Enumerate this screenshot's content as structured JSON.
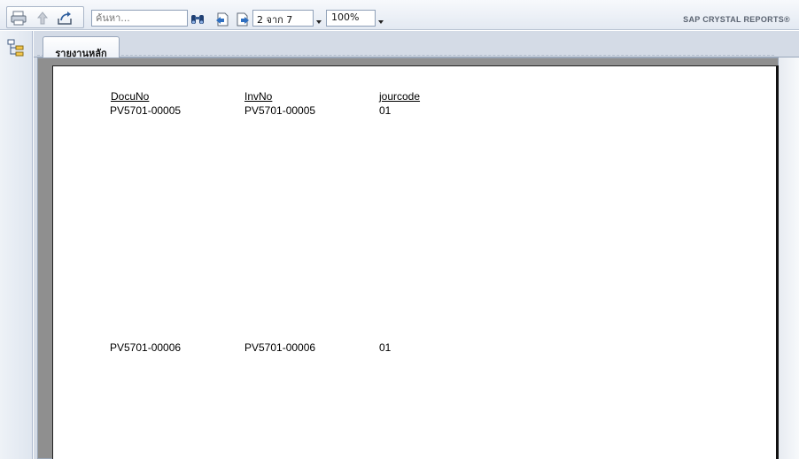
{
  "toolbar": {
    "search": {
      "placeholder": "ค้นหา..."
    },
    "page_indicator": "2 จาก 7",
    "zoom": "100%",
    "brand": "SAP CRYSTAL REPORTS®"
  },
  "tabs": [
    {
      "label": "รายงานหลัก"
    }
  ],
  "report": {
    "headers": {
      "docuno": "DocuNo",
      "invno": "InvNo",
      "jourcode": "jourcode"
    },
    "rows": [
      {
        "docuno": "PV5701-00005",
        "invno": "PV5701-00005",
        "jourcode": "01"
      },
      {
        "docuno": "PV5701-00006",
        "invno": "PV5701-00006",
        "jourcode": "01"
      }
    ]
  },
  "colors": {
    "toolbar_bg": "#e3e9f2",
    "page_surround": "#8f8f8f",
    "accent_blue": "#2f5f9e"
  },
  "icons": [
    "print-icon",
    "up-arrow-icon",
    "export-icon",
    "binoculars-icon",
    "prev-page-icon",
    "next-page-icon",
    "group-tree-icon"
  ]
}
